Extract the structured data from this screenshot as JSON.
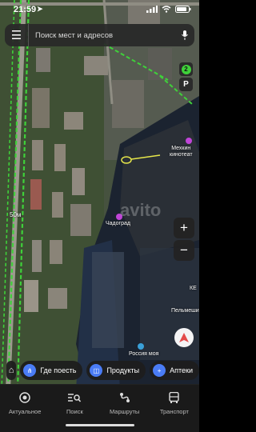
{
  "status_bar": {
    "time": "21:59",
    "location_glyph": "➤"
  },
  "search": {
    "placeholder": "Поиск мест и адресов"
  },
  "side_buttons": {
    "layers_count": "2",
    "parking_label": "P"
  },
  "map": {
    "scale_label": "50м",
    "labels": {
      "cinema": "Мехкин\nкинотеат",
      "chadograd": "Чадоград",
      "right_edge": "КЕ",
      "pelmeni": "Пельмеши",
      "russia": "Россия моя"
    },
    "watermark": "avito"
  },
  "chips": [
    {
      "label": "",
      "icon": "home-icon"
    },
    {
      "label": "Где поесть",
      "icon": "fork-knife-icon"
    },
    {
      "label": "Продукты",
      "icon": "basket-icon"
    },
    {
      "label": "Аптеки",
      "icon": "plus-icon"
    }
  ],
  "tabs": [
    {
      "label": "Актуальное",
      "icon": "target-icon"
    },
    {
      "label": "Поиск",
      "icon": "search-list-icon"
    },
    {
      "label": "Маршруты",
      "icon": "route-icon"
    },
    {
      "label": "Транспорт",
      "icon": "bus-icon"
    }
  ],
  "colors": {
    "route_green": "#3fd13a",
    "chip_blue": "#4a7cf5",
    "water": "#1a2230"
  }
}
